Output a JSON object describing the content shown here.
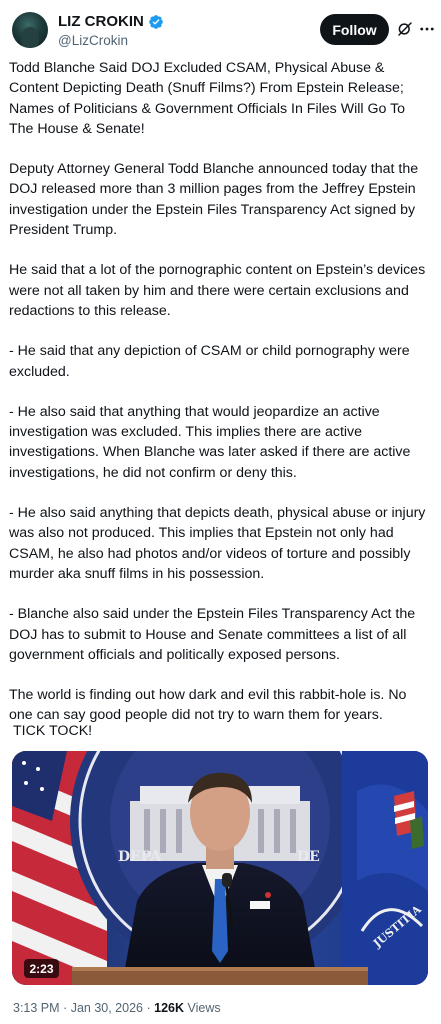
{
  "author": {
    "display_name": "LIZ CROKIN",
    "handle": "@LizCrokin",
    "verified": true,
    "avatar": "profile-photo"
  },
  "actions": {
    "follow_label": "Follow",
    "grok_icon": "grok-icon",
    "more_icon": "more-options-icon"
  },
  "tweet": {
    "paragraphs": [
      "Todd Blanche Said DOJ Excluded CSAM, Physical Abuse & Content Depicting Death (Snuff Films?) From Epstein Release; Names of Politicians & Government Officials In Files Will Go To The House & Senate!",
      "Deputy Attorney General Todd Blanche announced today that the DOJ released more than 3 million pages from the Jeffrey Epstein investigation under the Epstein Files Transparency Act signed by President Trump.",
      "He said that a lot of the pornographic content on Epstein’s devices were not all taken by him and there were certain exclusions and redactions to this release.",
      "- He said that any depiction of CSAM or child pornography were excluded.",
      "- He also said that anything that would jeopardize an active investigation was excluded. This implies there are active investigations. When Blanche was later asked if there are active investigations, he did not confirm or deny this.",
      "- He also said anything that depicts death, physical abuse or injury was also not produced. This implies that Epstein not only had CSAM, he also had photos and/or videos of torture and possibly murder aka snuff films in his possession.",
      "- Blanche also said under the Epstein Files Transparency Act the DOJ has to submit to House and Senate committees a list of all government officials and politically exposed persons.",
      "The world is finding out how dark and evil this rabbit-hole is. No one can say good people did not try to warn them for years."
    ],
    "closing": "TICK TOCK!"
  },
  "media": {
    "type": "video",
    "duration": "2:23",
    "seal_text_left": "DEPA",
    "seal_text_right": "DE",
    "flag_text": "JUSTITIA"
  },
  "meta": {
    "time": "3:13 PM",
    "separator": "·",
    "date": "Jan 30, 2026",
    "views_count": "126K",
    "views_label": "Views"
  },
  "colors": {
    "text": "#0f1419",
    "secondary": "#536471",
    "verified": "#1d9bf0",
    "button": "#0f1419"
  }
}
